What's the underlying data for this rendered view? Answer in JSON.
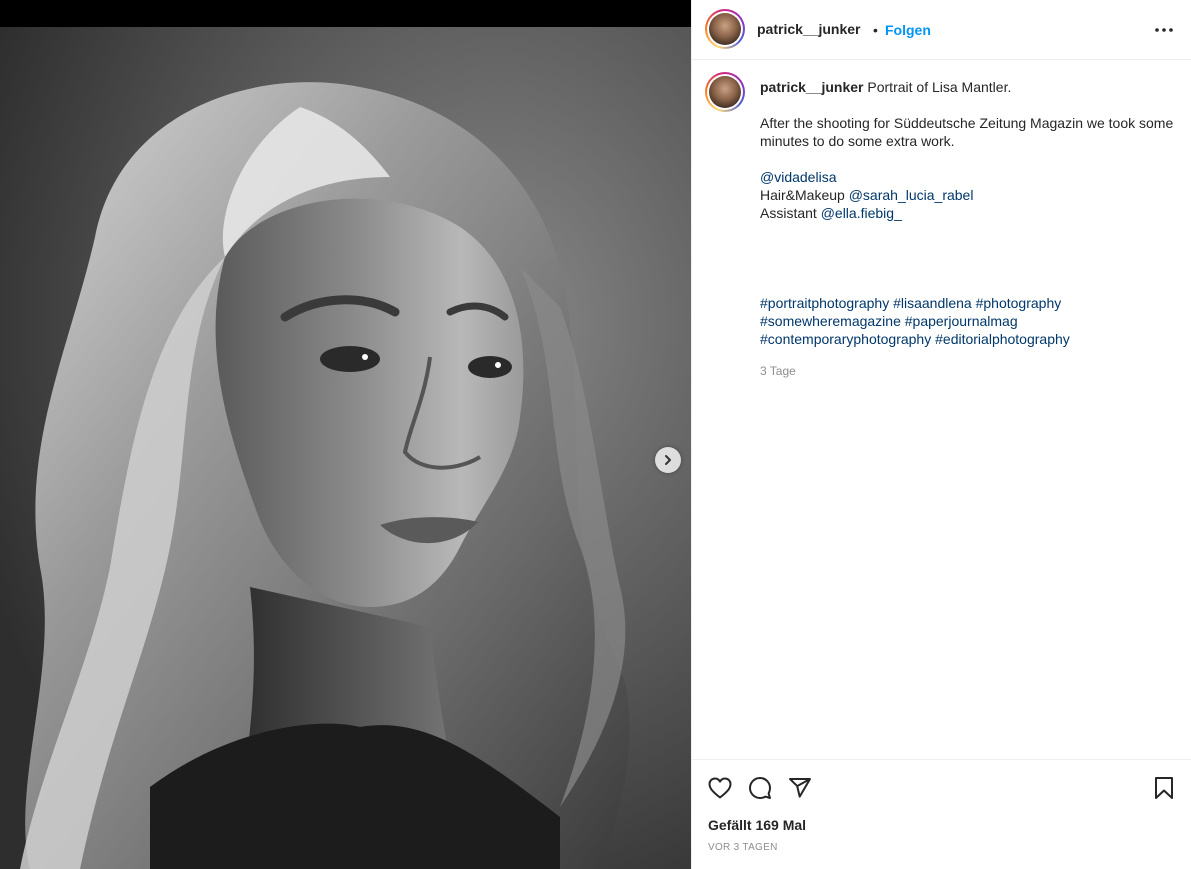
{
  "post": {
    "author": "patrick__junker",
    "follow_label": "Folgen",
    "separator": "•",
    "more_icon": "more-horizontal-icon"
  },
  "caption": {
    "username": "patrick__junker",
    "title": "Portrait of Lisa Mantler.",
    "paragraph": "After the shooting for Süddeutsche Zeitung Magazin we took some minutes to do some extra work.",
    "model_mention": "@vidadelisa",
    "hair_label": "Hair&Makeup",
    "hair_mention": "@sarah_lucia_rabel",
    "assistant_label": "Assistant",
    "assistant_mention": "@ella.fiebig_",
    "hashtags": [
      "#portraitphotography",
      "#lisaandlena",
      "#photography",
      "#somewheremagazine",
      "#paperjournalmag",
      "#contemporaryphotography",
      "#editorialphotography"
    ],
    "time": "3 Tage"
  },
  "actions": {
    "like_icon": "heart-icon",
    "comment_icon": "comment-icon",
    "share_icon": "send-icon",
    "save_icon": "bookmark-icon"
  },
  "stats": {
    "likes_text": "Gefällt 169 Mal",
    "posted_text": "VOR 3 TAGEN"
  },
  "media": {
    "next_icon": "chevron-right-icon"
  }
}
